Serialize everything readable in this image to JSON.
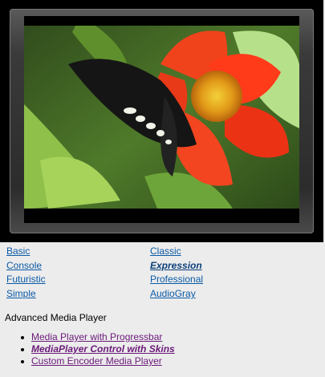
{
  "player": {
    "video_description_icon": "butterfly-on-orange-flower"
  },
  "skins": {
    "items": [
      {
        "label": "Basic",
        "active": false
      },
      {
        "label": "Classic",
        "active": false
      },
      {
        "label": "Console",
        "active": false
      },
      {
        "label": "Expression",
        "active": true
      },
      {
        "label": "Futuristic",
        "active": false
      },
      {
        "label": "Professional",
        "active": false
      },
      {
        "label": "Simple",
        "active": false
      },
      {
        "label": "AudioGray",
        "active": false
      }
    ]
  },
  "advanced": {
    "title": "Advanced Media Player",
    "items": [
      {
        "label": "Media Player with Progressbar",
        "active": false
      },
      {
        "label": "MediaPlayer Control with Skins",
        "active": true
      },
      {
        "label": "Custom Encoder Media Player",
        "active": false
      }
    ]
  },
  "colors": {
    "link": "#0b5aa6",
    "visited_link": "#6b1a7a",
    "background": "#ececec"
  }
}
